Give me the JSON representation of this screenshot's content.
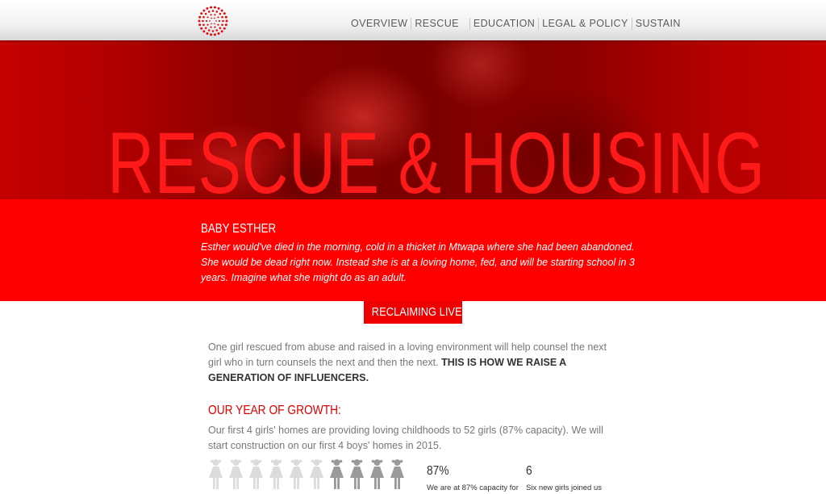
{
  "nav": {
    "items": [
      "OVERVIEW",
      "RESCUE",
      "EDUCATION",
      "LEGAL & POLICY",
      "SUSTAIN"
    ]
  },
  "hero": {
    "title": "RESCUE & HOUSING"
  },
  "story": {
    "name": "BABY ESTHER",
    "text": "Esther would've died in the morning, cold in a thicket in Mtwapa where she had been abandoned. She would be dead right now. Instead she is at a loving home, fed, and will be starting school in 3 years. Imagine what she might do as an adult."
  },
  "section": {
    "label": "RECLAIMING LIVES",
    "intro": "One girl rescued from abuse and raised in a loving environment will help counsel the next girl who in turn counsels the next and then the next.",
    "intro_bold": "THIS IS HOW WE RAISE A GENERATION OF INFLUENCERS."
  },
  "growth": {
    "heading": "OUR YEAR OF GROWTH:",
    "text": "Our first 4 girls' homes are providing loving childhoods to 52 girls (87% capacity). We will start construction on our first 4 boys' homes in 2015.",
    "figures": {
      "total": 10,
      "highlighted_from": 6
    },
    "stats": [
      {
        "value": "87%",
        "caption": "We are at 87% capacity for"
      },
      {
        "value": "6",
        "caption": "Six new girls joined us"
      }
    ]
  },
  "colors": {
    "brand_red": "#ff0000",
    "label_red": "#ee0000",
    "figure_light": "#dcdcdc",
    "figure_dark": "#9a9a9a"
  },
  "icons": {
    "logo": "dotted-circle-logo",
    "figure": "girl-figure-icon"
  }
}
